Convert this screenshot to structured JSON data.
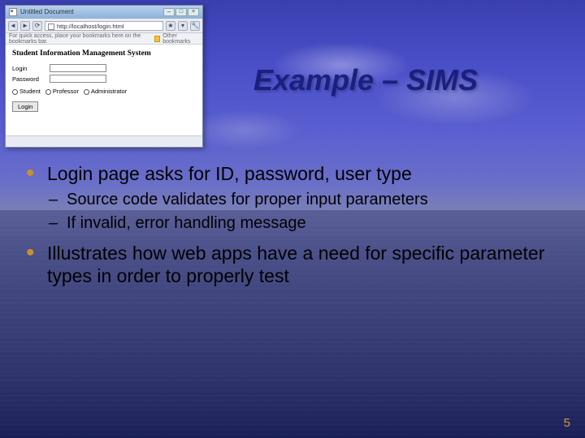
{
  "slide": {
    "title": "Example – SIMS",
    "number": "5"
  },
  "bullets": {
    "b1": "Login page asks for ID, password, user type",
    "b1_sub1": "Source code validates for proper input parameters",
    "b1_sub2": "If invalid, error handling message",
    "b2": "Illustrates how web apps have a need for specific parameter types in order to properly test"
  },
  "browser": {
    "tab_title": "Untitled Document",
    "url_prefix": "http://",
    "url": "localhost/login.html",
    "bookmarks_hint": "For quick access, place your bookmarks here on the bookmarks bar.",
    "bookmarks_other": "Other bookmarks",
    "page_heading": "Student Information Management System",
    "label_login": "Login",
    "label_password": "Password",
    "radio_student": "Student",
    "radio_professor": "Professor",
    "radio_admin": "Administrator",
    "submit_label": "Login"
  }
}
